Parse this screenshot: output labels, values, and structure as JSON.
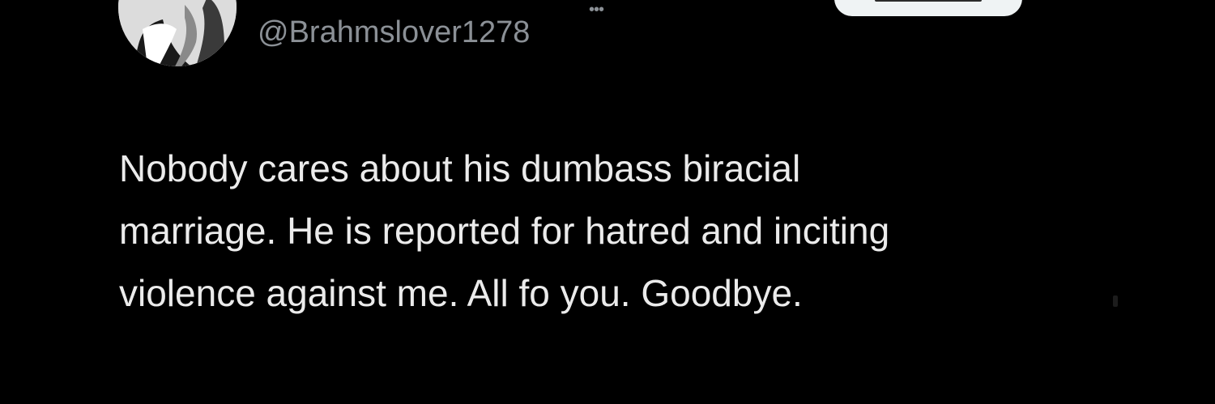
{
  "author": {
    "handle": "@Brahmslover1278",
    "avatar_icon": "profile-photo",
    "more_icon": "ellipsis-icon"
  },
  "follow_button": {
    "label": ""
  },
  "tweet": {
    "lines": [
      "Nobody cares about his dumbass biracial",
      "marriage. He is reported for hatred and inciting",
      "violence against me. All fo you. Goodbye."
    ]
  },
  "colors": {
    "background": "#000000",
    "text": "#ebebeb",
    "handle": "#8b9096",
    "button": "#eff3f4"
  }
}
